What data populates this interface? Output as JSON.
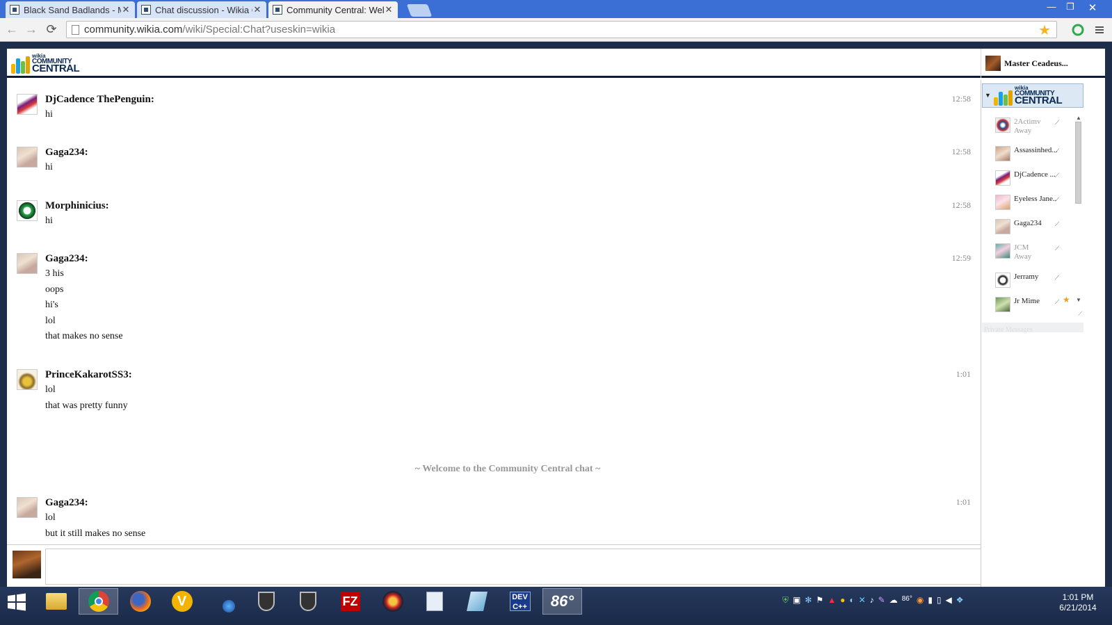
{
  "browser": {
    "tabs": [
      {
        "title": "Black Sand Badlands - Mo",
        "active": false
      },
      {
        "title": "Chat discussion - Wikia C",
        "active": false
      },
      {
        "title": "Community Central: Welc",
        "active": true
      }
    ],
    "tab_close_glyph": "✕",
    "url_host": "community.wikia.com",
    "url_path": "/wiki/Special:Chat?useskin=wikia"
  },
  "header": {
    "logo_small": "wikia",
    "logo_line1": "COMMUNITY",
    "logo_line2": "CENTRAL",
    "current_user": "Master Ceadeus..."
  },
  "messages": [
    {
      "user": "DjCadence ThePenguin:",
      "time": "12:58",
      "lines": [
        "hi"
      ]
    },
    {
      "user": "Gaga234:",
      "time": "12:58",
      "lines": [
        "hi"
      ]
    },
    {
      "user": "Morphinicius:",
      "time": "12:58",
      "lines": [
        "hi"
      ]
    },
    {
      "user": "Gaga234:",
      "time": "12:59",
      "lines": [
        "3 his",
        "oops",
        "hi's",
        "lol",
        "that makes no sense"
      ]
    },
    {
      "user": "PrinceKakarotSS3:",
      "time": "1:01",
      "lines": [
        "lol",
        "that was pretty funny"
      ]
    },
    {
      "user": "Gaga234:",
      "time": "1:01",
      "lines": [
        "lol",
        "but it still makes no sense"
      ]
    }
  ],
  "welcome_message": "~ Welcome to the Community Central chat ~",
  "sidebar": {
    "users": [
      {
        "name": "2Actimv",
        "status": "Away"
      },
      {
        "name": "Assassinhed...",
        "status": ""
      },
      {
        "name": "DjCadence ...",
        "status": ""
      },
      {
        "name": "Eyeless Jane...",
        "status": ""
      },
      {
        "name": "Gaga234",
        "status": ""
      },
      {
        "name": "JCM",
        "status": "Away"
      },
      {
        "name": "Jerramy",
        "status": ""
      },
      {
        "name": "Jr Mime",
        "status": ""
      }
    ],
    "private_messages_label": "Private Messages"
  },
  "taskbar": {
    "temperature": "86°",
    "clock_time": "1:01 PM",
    "clock_date": "6/21/2014"
  },
  "colors": {
    "tab_bar": "#3b6fd6",
    "header_border": "#0b1d36",
    "welcome_text": "#999999",
    "taskbar": "#1f3050"
  }
}
